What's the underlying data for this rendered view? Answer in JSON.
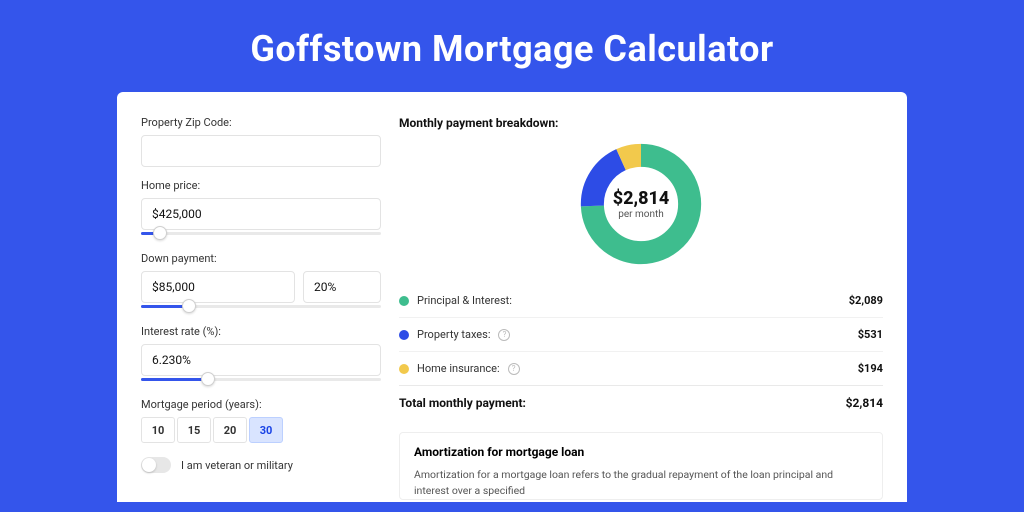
{
  "title": "Goffstown Mortgage Calculator",
  "form": {
    "zip": {
      "label": "Property Zip Code:",
      "value": ""
    },
    "home_price": {
      "label": "Home price:",
      "value": "$425,000",
      "slider_pct": 8
    },
    "down_payment": {
      "label": "Down payment:",
      "amount": "$85,000",
      "percent": "20%",
      "slider_pct": 20
    },
    "interest": {
      "label": "Interest rate (%):",
      "value": "6.230%",
      "slider_pct": 28
    },
    "period": {
      "label": "Mortgage period (years):",
      "options": [
        "10",
        "15",
        "20",
        "30"
      ],
      "selected": "30"
    },
    "veteran": {
      "label": "I am veteran or military",
      "on": false
    }
  },
  "breakdown": {
    "title": "Monthly payment breakdown:",
    "center_value": "$2,814",
    "center_sub": "per month",
    "items": [
      {
        "label": "Principal & Interest:",
        "value": "$2,089",
        "color": "#3ebd8e",
        "help": false
      },
      {
        "label": "Property taxes:",
        "value": "$531",
        "color": "#2d4ce6",
        "help": true
      },
      {
        "label": "Home insurance:",
        "value": "$194",
        "color": "#f2c94c",
        "help": true
      }
    ],
    "total": {
      "label": "Total monthly payment:",
      "value": "$2,814"
    }
  },
  "amortization": {
    "title": "Amortization for mortgage loan",
    "body": "Amortization for a mortgage loan refers to the gradual repayment of the loan principal and interest over a specified"
  },
  "chart_data": {
    "type": "pie",
    "title": "Monthly payment breakdown",
    "series": [
      {
        "name": "Principal & Interest",
        "value": 2089,
        "color": "#3ebd8e"
      },
      {
        "name": "Property taxes",
        "value": 531,
        "color": "#2d4ce6"
      },
      {
        "name": "Home insurance",
        "value": 194,
        "color": "#f2c94c"
      }
    ],
    "total": 2814,
    "donut_inner_radius_pct": 62
  }
}
